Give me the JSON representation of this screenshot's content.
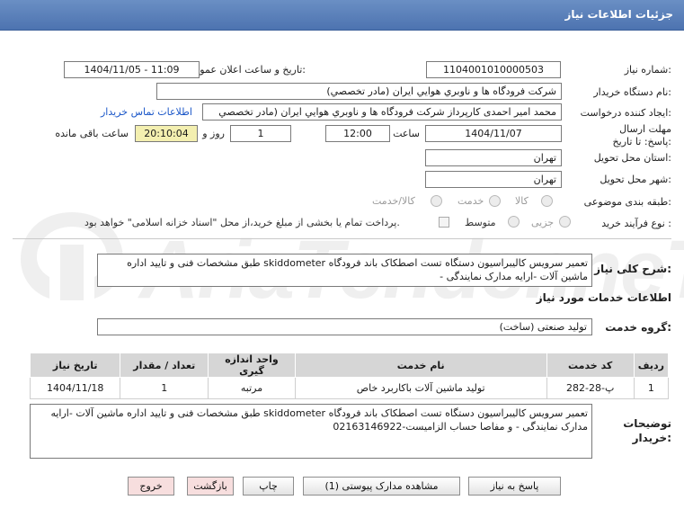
{
  "header": {
    "title": "جزئیات اطلاعات نیاز"
  },
  "form": {
    "need_number_label": "شماره نیاز:",
    "need_number": "1104001010000503",
    "announce_label": "تاریخ و ساعت اعلان عمومی:",
    "announce_value": "1404/11/05 - 11:09",
    "buyer_org_label": "نام دستگاه خریدار:",
    "buyer_org": "شرکت فرودگاه ها و ناوبري هوايي ايران (مادر تخصصي)",
    "creator_label": "ایجاد کننده درخواست:",
    "creator": "محمد امیر احمدی کارپرداز شرکت فرودگاه ها و ناوبري هوايي ايران (مادر تخصصي",
    "contact_link": "اطلاعات تماس خریدار",
    "deadline_label": "مهلت ارسال پاسخ: تا تاریخ:",
    "deadline_date": "1404/11/07",
    "time_label": "ساعت",
    "deadline_time": "12:00",
    "days_value": "1",
    "days_label": "روز و",
    "remaining_time": "20:10:04",
    "remaining_label": "ساعت باقی مانده",
    "province_label": "استان محل تحویل:",
    "province": "تهران",
    "city_label": "شهر محل تحویل:",
    "city": "تهران",
    "category_label": "طبقه بندی موضوعی:",
    "category_options": [
      "کالا",
      "خدمت",
      "کالا/خدمت"
    ],
    "process_label": "نوع فرآیند خرید :",
    "process_options": [
      "جزیی",
      "متوسط"
    ],
    "payment_note": "پرداخت تمام یا بخشی از مبلغ خرید،از محل \"اسناد خزانه اسلامی\" خواهد بود."
  },
  "summary": {
    "label": "شرح کلی نیاز:",
    "text": "تعمیر سرویس کالیبراسیون دستگاه تست اصطکاک باند فرودگاه skiddometer طبق مشخصات فنی و تایید اداره ماشین آلات -ارایه مدارک نمایندگی -"
  },
  "services_title": "اطلاعات خدمات مورد نیاز",
  "service_group": {
    "label": "گروه خدمت:",
    "value": "تولید صنعتی (ساخت)"
  },
  "table": {
    "headers": [
      "ردیف",
      "کد خدمت",
      "نام خدمت",
      "واحد اندازه گیری",
      "تعداد / مقدار",
      "تاریخ نیاز"
    ],
    "rows": [
      [
        "1",
        "پ-28-282",
        "تولید ماشین آلات باکاربرد خاص",
        "مرتبه",
        "1",
        "1404/11/18"
      ]
    ]
  },
  "buyer_notes": {
    "label": "توضیحات خریدار:",
    "text": "تعمیر سرویس کالیبراسیون دستگاه تست اصطکاک باند فرودگاه skiddometer طبق مشخصات فنی و تایید اداره ماشین آلات -ارایه مدارک نمایندگی - و مفاصا حساب الزامیست-02163146922"
  },
  "buttons": {
    "reply": "پاسخ به نیاز",
    "attachments": "مشاهده مدارک پیوستی (1)",
    "print": "چاپ",
    "back": "بازگشت",
    "exit": "خروج"
  },
  "watermark_text": "AriaTender.neT"
}
